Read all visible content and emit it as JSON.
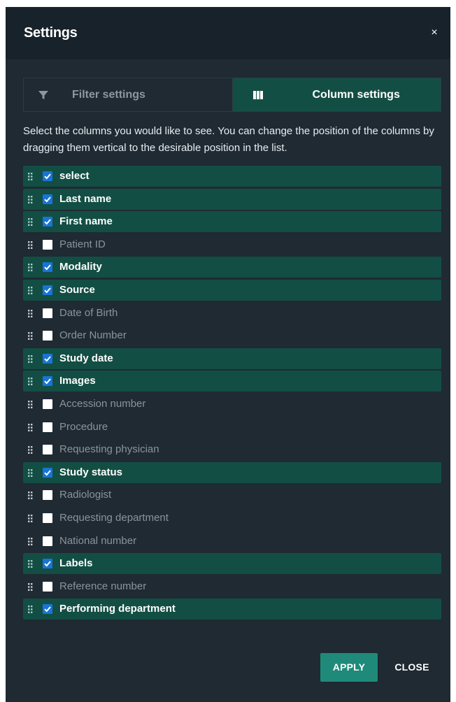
{
  "dialog": {
    "title": "Settings",
    "close_glyph": "×"
  },
  "tabs": [
    {
      "label": "Filter settings",
      "icon": "filter-icon",
      "active": false
    },
    {
      "label": "Column settings",
      "icon": "columns-icon",
      "active": true
    }
  ],
  "description": "Select the columns you would like to see. You can change the position of the columns by dragging them vertical to the desirable position in the list.",
  "columns": [
    {
      "label": "select",
      "checked": true
    },
    {
      "label": "Last name",
      "checked": true
    },
    {
      "label": "First name",
      "checked": true
    },
    {
      "label": "Patient ID",
      "checked": false
    },
    {
      "label": "Modality",
      "checked": true
    },
    {
      "label": "Source",
      "checked": true
    },
    {
      "label": "Date of Birth",
      "checked": false
    },
    {
      "label": "Order Number",
      "checked": false
    },
    {
      "label": "Study date",
      "checked": true
    },
    {
      "label": "Images",
      "checked": true
    },
    {
      "label": "Accession number",
      "checked": false
    },
    {
      "label": "Procedure",
      "checked": false
    },
    {
      "label": "Requesting physician",
      "checked": false
    },
    {
      "label": "Study status",
      "checked": true
    },
    {
      "label": "Radiologist",
      "checked": false
    },
    {
      "label": "Requesting department",
      "checked": false
    },
    {
      "label": "National number",
      "checked": false
    },
    {
      "label": "Labels",
      "checked": true
    },
    {
      "label": "Reference number",
      "checked": false
    },
    {
      "label": "Performing department",
      "checked": true
    }
  ],
  "buttons": {
    "apply": "APPLY",
    "close": "CLOSE"
  },
  "colors": {
    "dialog_bg": "#1f2a33",
    "header_bg": "#18222a",
    "checked_row_bg": "#134e44",
    "checkbox_checked": "#1874d6",
    "apply_button": "#1f8a79"
  }
}
